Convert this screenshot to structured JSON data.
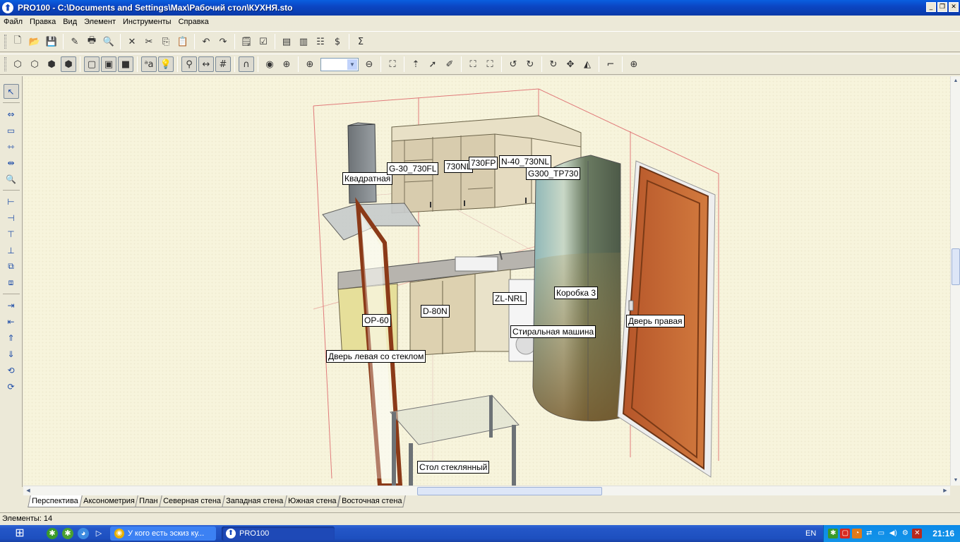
{
  "window": {
    "title": "PRO100 - C:\\Documents and Settings\\Max\\Рабочий стол\\КУХНЯ.sto",
    "minimize_glyph": "_",
    "maximize_glyph": "❐",
    "close_glyph": "✕"
  },
  "menu": [
    "Файл",
    "Правка",
    "Вид",
    "Элемент",
    "Инструменты",
    "Справка"
  ],
  "toolbar1": [
    {
      "name": "new-file-icon",
      "glyph": "🗋"
    },
    {
      "name": "open-folder-icon",
      "glyph": "📂"
    },
    {
      "name": "save-icon",
      "glyph": "💾"
    },
    {
      "name": "edit-page-icon",
      "glyph": "✎"
    },
    {
      "name": "print-icon",
      "glyph": "🖶"
    },
    {
      "name": "print-preview-icon",
      "glyph": "🔍"
    },
    {
      "name": "delete-icon",
      "glyph": "✕"
    },
    {
      "name": "cut-icon",
      "glyph": "✂"
    },
    {
      "name": "copy-icon",
      "glyph": "⎘"
    },
    {
      "name": "paste-icon",
      "glyph": "📋"
    },
    {
      "name": "undo-icon",
      "glyph": "↶"
    },
    {
      "name": "redo-icon",
      "glyph": "↷"
    },
    {
      "name": "properties-icon",
      "glyph": "🗒"
    },
    {
      "name": "checklist-icon",
      "glyph": "☑"
    },
    {
      "name": "library-icon",
      "glyph": "▤"
    },
    {
      "name": "catalog-icon",
      "glyph": "▥"
    },
    {
      "name": "tree-icon",
      "glyph": "☷"
    },
    {
      "name": "pricing-icon",
      "glyph": "$"
    },
    {
      "name": "sum-icon",
      "glyph": "Σ"
    }
  ],
  "toolbar2": [
    {
      "name": "view-cube-wire-icon",
      "glyph": "⬡"
    },
    {
      "name": "view-cube-outline-icon",
      "glyph": "⬡"
    },
    {
      "name": "view-cube-shaded-icon",
      "glyph": "⬢"
    },
    {
      "name": "view-cube-textured-icon",
      "glyph": "⬢",
      "pressed": true
    },
    {
      "name": "render-wire-icon",
      "glyph": "▢",
      "pressed": true
    },
    {
      "name": "render-hidden-icon",
      "glyph": "▣",
      "pressed": true
    },
    {
      "name": "render-solid-icon",
      "glyph": "■",
      "pressed": true
    },
    {
      "name": "labels-icon",
      "glyph": "ᵃa",
      "pressed": true
    },
    {
      "name": "light-bulb-icon",
      "glyph": "💡",
      "pressed": true
    },
    {
      "name": "measure-icon",
      "glyph": "⚲",
      "pressed": true
    },
    {
      "name": "dimension-icon",
      "glyph": "↔",
      "pressed": true
    },
    {
      "name": "grid-icon",
      "glyph": "#",
      "pressed": true
    },
    {
      "name": "magnet-icon",
      "glyph": "∩",
      "pressed": true
    },
    {
      "name": "target-icon",
      "glyph": "◉"
    },
    {
      "name": "crosshair-icon",
      "glyph": "⊕"
    },
    {
      "name": "zoom-in-icon",
      "glyph": "⊕"
    },
    {
      "name": "zoom-out-icon",
      "glyph": "⊖"
    },
    {
      "name": "select-all-icon",
      "glyph": "⛶"
    },
    {
      "name": "move-up-icon",
      "glyph": "⇡"
    },
    {
      "name": "pointer-icon",
      "glyph": "➚"
    },
    {
      "name": "pen-icon",
      "glyph": "✐"
    },
    {
      "name": "frame-select-icon",
      "glyph": "⛶"
    },
    {
      "name": "frame-plus-icon",
      "glyph": "⛶"
    },
    {
      "name": "rotate-left-icon",
      "glyph": "↺"
    },
    {
      "name": "rotate-axis-icon",
      "glyph": "↻"
    },
    {
      "name": "rotate-icon",
      "glyph": "↻"
    },
    {
      "name": "move-icon",
      "glyph": "✥"
    },
    {
      "name": "mirror-icon",
      "glyph": "◭"
    },
    {
      "name": "corner-icon",
      "glyph": "⌐"
    },
    {
      "name": "snap-target-icon",
      "glyph": "⊕"
    }
  ],
  "lefttools": [
    {
      "name": "select-tool-icon",
      "glyph": "↖",
      "pressed": true
    },
    {
      "name": "split-tool-icon",
      "glyph": "⇔"
    },
    {
      "name": "box-tool-icon",
      "glyph": "▭"
    },
    {
      "name": "distribute-tool-icon",
      "glyph": "⇿"
    },
    {
      "name": "align-tool-icon",
      "glyph": "⇹"
    },
    {
      "name": "search-tool-icon",
      "glyph": "🔍"
    },
    {
      "name": "align-left-icon",
      "glyph": "⊢"
    },
    {
      "name": "align-right-icon",
      "glyph": "⊣"
    },
    {
      "name": "align-top-icon",
      "glyph": "⊤"
    },
    {
      "name": "align-bottom-icon",
      "glyph": "⊥"
    },
    {
      "name": "group-icon",
      "glyph": "⧉"
    },
    {
      "name": "ungroup-icon",
      "glyph": "⧈"
    },
    {
      "name": "spacing-h-icon",
      "glyph": "⇥"
    },
    {
      "name": "spacing-v-icon",
      "glyph": "⇤"
    },
    {
      "name": "stack-up-icon",
      "glyph": "⇑"
    },
    {
      "name": "stack-down-icon",
      "glyph": "⇓"
    },
    {
      "name": "hinge-icon",
      "glyph": "⟲"
    },
    {
      "name": "hinge-2-icon",
      "glyph": "⟳"
    }
  ],
  "scene_labels": [
    {
      "text": "Квадратная"
    },
    {
      "text": "G-30_730FL"
    },
    {
      "text": "730NL"
    },
    {
      "text": "730FP"
    },
    {
      "text": "N-40_730NL"
    },
    {
      "text": "G300_TP730"
    },
    {
      "text": "Коробка 3"
    },
    {
      "text": "ZL-NRL"
    },
    {
      "text": "D-80N"
    },
    {
      "text": "OP-60"
    },
    {
      "text": "Стиральная машина"
    },
    {
      "text": "Дверь правая"
    },
    {
      "text": "Дверь левая со стеклом"
    },
    {
      "text": "Стол стеклянный"
    }
  ],
  "tabs": [
    {
      "label": "Перспектива",
      "active": true
    },
    {
      "label": "Аксонометрия"
    },
    {
      "label": "План"
    },
    {
      "label": "Северная стена"
    },
    {
      "label": "Западная стена"
    },
    {
      "label": "Южная стена"
    },
    {
      "label": "Восточная стена"
    }
  ],
  "status": "Элементы: 14",
  "taskbar": {
    "tasks": [
      {
        "label": "У кого есть эскиз ку...",
        "active": false,
        "icon": "chrome-icon"
      },
      {
        "label": "PRO100",
        "active": true,
        "icon": "pro100-icon"
      }
    ],
    "language": "EN",
    "clock": "21:16"
  }
}
